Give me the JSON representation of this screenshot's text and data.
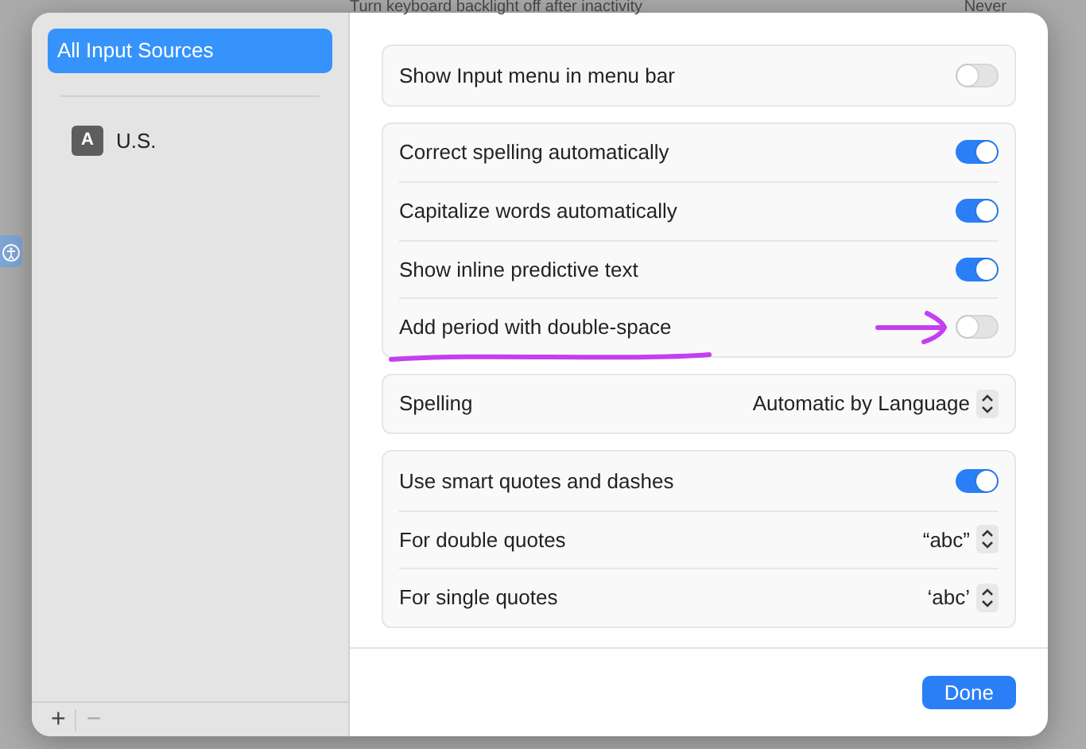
{
  "background": {
    "setting_label": "Turn keyboard backlight off after inactivity",
    "setting_value": "Never"
  },
  "sidebar": {
    "items": [
      {
        "kind": "heading",
        "label": "All Input Sources",
        "selected": true
      },
      {
        "kind": "source",
        "badge": "A",
        "label": "U.S.",
        "selected": false
      }
    ],
    "add_button": "+",
    "remove_button": "−",
    "remove_disabled": true
  },
  "groups": [
    {
      "rows": [
        {
          "kind": "toggle",
          "label": "Show Input menu in menu bar",
          "on": false
        }
      ]
    },
    {
      "rows": [
        {
          "kind": "toggle",
          "label": "Correct spelling automatically",
          "on": true
        },
        {
          "kind": "toggle",
          "label": "Capitalize words automatically",
          "on": true
        },
        {
          "kind": "toggle",
          "label": "Show inline predictive text",
          "on": true
        },
        {
          "kind": "toggle",
          "label": "Add period with double-space",
          "on": false
        }
      ]
    },
    {
      "rows": [
        {
          "kind": "popup",
          "label": "Spelling",
          "value": "Automatic by Language"
        }
      ]
    },
    {
      "rows": [
        {
          "kind": "toggle",
          "label": "Use smart quotes and dashes",
          "on": true
        },
        {
          "kind": "popup",
          "label": "For double quotes",
          "value": "“abc”"
        },
        {
          "kind": "popup",
          "label": "For single quotes",
          "value": "‘abc’"
        }
      ]
    }
  ],
  "done_button": "Done",
  "annotations": {
    "underline": true,
    "arrow": true
  }
}
